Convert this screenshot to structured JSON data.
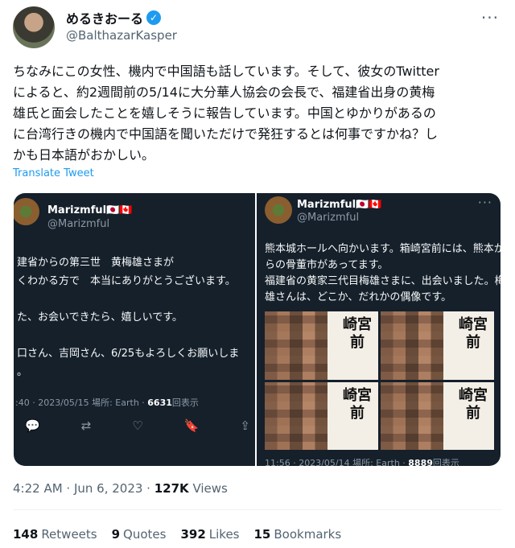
{
  "author": {
    "name": "めるきおーる",
    "handle": "@BalthazarKasper"
  },
  "tweet": {
    "lines": [
      "ちなみにこの女性、機内で中国語も話しています。そして、彼女のTwitter",
      "によると、約2週間前の5/14に大分華人協会の会長で、福建省出身の黄梅",
      "雄氏と面会したことを嬉しそうに報告しています。中国とゆかりがあるの",
      "に台湾行きの機内で中国語を聞いただけで発狂するとは何事ですかね？し",
      "かも日本語がおかしい。"
    ],
    "translate_label": "Translate Tweet",
    "time": "4:22 AM · Jun 6, 2023 · ",
    "views_count": "127K",
    "views_label": " Views"
  },
  "embedded": {
    "left": {
      "name": "Marizmful🇯🇵🇨🇦",
      "handle": "@Marizmful",
      "lines": [
        "建省からの第三世　黄梅雄さまが",
        "くわかる方で　本当にありがとうございます。",
        "た、お会いできたら、嬉しいです。",
        "口さん、吉岡さん、6/25もよろしくお願いしま",
        "。"
      ],
      "meta": ":40 · 2023/05/15 場所: Earth · ",
      "views": "6631",
      "views_label": "回表示"
    },
    "right": {
      "name": "Marizmful🇯🇵🇨🇦",
      "handle": "@Marizmful",
      "lines": [
        "熊本城ホールへ向かいます。箱崎宮前には、熊本か",
        "らの骨董市があってます。",
        "福建省の黄家三代目梅雄さまに、出会いました。梅",
        "雄さんは、どこか、だれかの偶像です。"
      ],
      "sign_text": "崎宮前",
      "meta": "11:56 · 2023/05/14 場所: Earth · ",
      "views": "8889",
      "views_label": "回表示"
    }
  },
  "stats": {
    "retweets_count": "148",
    "retweets_label": "Retweets",
    "quotes_count": "9",
    "quotes_label": "Quotes",
    "likes_count": "392",
    "likes_label": "Likes",
    "bookmarks_count": "15",
    "bookmarks_label": "Bookmarks"
  }
}
